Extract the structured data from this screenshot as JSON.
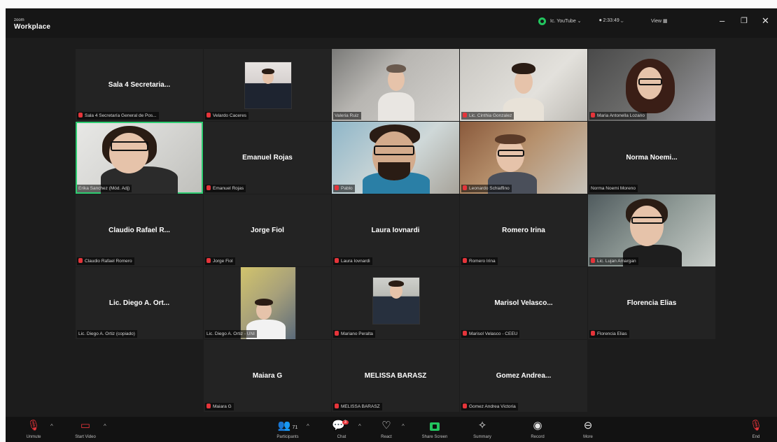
{
  "titlebar": {
    "app_top": "zoom",
    "app_name": "Workplace",
    "user": "Ic. YouTube",
    "timer": "2:33:49",
    "view": "View"
  },
  "tiles": [
    {
      "id": "t1",
      "big": "Sala 4 Secretaria...",
      "label": "Sala 4 Secretaría General de Pos...",
      "mic_muted": true
    },
    {
      "id": "t2",
      "big": "",
      "label": "Velardo Caceres",
      "mic_muted": true
    },
    {
      "id": "t3",
      "big": "",
      "label": "Valeria Ruiz",
      "mic_muted": false
    },
    {
      "id": "t4",
      "big": "",
      "label": "Lic. Cinthia Gonzalez",
      "mic_muted": true
    },
    {
      "id": "t5",
      "big": "",
      "label": "Maria Antonella Lozano",
      "mic_muted": true
    },
    {
      "id": "t6",
      "big": "",
      "label": "Erika Sanchez (Mód. Adj)",
      "mic_muted": false
    },
    {
      "id": "t7",
      "big": "Emanuel Rojas",
      "label": "Emanuel Rojas",
      "mic_muted": true
    },
    {
      "id": "t8",
      "big": "",
      "label": "Pablo",
      "mic_muted": true
    },
    {
      "id": "t9",
      "big": "",
      "label": "Leonardo Schiaffino",
      "mic_muted": true
    },
    {
      "id": "t10",
      "big": "Norma Noemi...",
      "label": "Norma Noemi Moreno",
      "mic_muted": false
    },
    {
      "id": "t11",
      "big": "Claudio Rafael R...",
      "label": "Claudio Rafael Romero",
      "mic_muted": true
    },
    {
      "id": "t12",
      "big": "Jorge Fiol",
      "label": "Jorge Fiol",
      "mic_muted": true
    },
    {
      "id": "t13",
      "big": "Laura Iovnardi",
      "label": "Laura Iovnardi",
      "mic_muted": true
    },
    {
      "id": "t14",
      "big": "Romero Irina",
      "label": "Romero Irina",
      "mic_muted": true
    },
    {
      "id": "t15",
      "big": "",
      "label": "Lic. Lujan Amargan",
      "mic_muted": true
    },
    {
      "id": "t16",
      "big": "Lic. Diego A. Ort...",
      "label": "Lic. Diego A. Ortiz (copiado)",
      "mic_muted": false
    },
    {
      "id": "t17",
      "big": "",
      "label": "Lic. Diego A. Ortiz - UNI",
      "mic_muted": false
    },
    {
      "id": "t18",
      "big": "",
      "label": "Mariano Peralta",
      "mic_muted": true
    },
    {
      "id": "t19",
      "big": "Marisol Velasco...",
      "label": "Marisol Velasco - CEEU",
      "mic_muted": true
    },
    {
      "id": "t20",
      "big": "Florencia Elias",
      "label": "Florencia Elias",
      "mic_muted": true
    },
    {
      "id": "t21",
      "big": "Maiara G",
      "label": "Maiara G",
      "mic_muted": true
    },
    {
      "id": "t22",
      "big": "MELISSA BARASZ",
      "label": "MELISSA BARASZ",
      "mic_muted": true
    },
    {
      "id": "t23",
      "big": "Gomez Andrea...",
      "label": "Gomez Andrea Victoria",
      "mic_muted": true
    }
  ],
  "toolbar": {
    "unmute": "Unmute",
    "start_video": "Start Video",
    "participants": "Participants",
    "participants_count": "71",
    "chat": "Chat",
    "chat_badge": "3",
    "react": "React",
    "share": "Share Screen",
    "summary": "Summary",
    "record": "Record",
    "more": "More",
    "end": "End"
  }
}
